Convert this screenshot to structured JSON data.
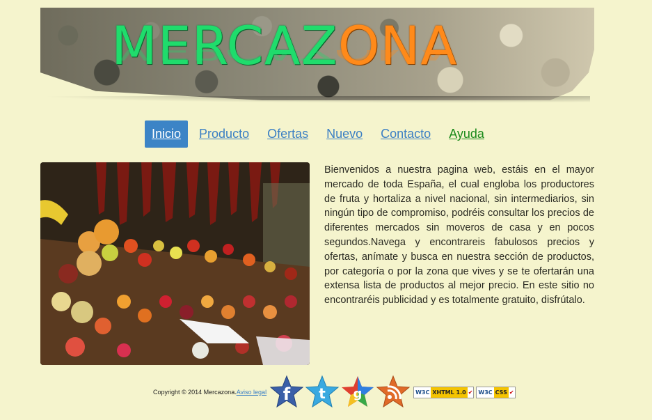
{
  "header": {
    "logo_part1": "MERCAZ",
    "logo_part2": "ONA",
    "logo_colors": {
      "part1": "#1fdc6c",
      "part2": "#ff8a1a"
    }
  },
  "nav": {
    "items": [
      {
        "label": "Inicio",
        "active": true
      },
      {
        "label": "Producto"
      },
      {
        "label": "Ofertas"
      },
      {
        "label": "Nuevo"
      },
      {
        "label": "Contacto"
      },
      {
        "label": "Ayuda",
        "color": "#1a8a1a"
      }
    ],
    "active_color": "#3c84c6",
    "link_color": "#3b7fc4"
  },
  "main": {
    "image_icon": "market-stall-photo",
    "intro_text": "Bienvenidos a nuestra pagina web, estáis en el mayor mercado de toda España, el cual engloba los productores de fruta y hortaliza a nivel nacional, sin intermediarios, sin ningún tipo de compromiso, podréis consultar los precios de diferentes mercados sin moveros de casa y en pocos segundos.Navega y encontrareis fabulosos precios y ofertas, anímate y busca en nuestra sección de productos, por categoría o por la zona que vives y se te ofertarán una extensa lista de productos al mejor precio. En este sitio no encontraréis publicidad y es totalmente gratuito, disfrútalo."
  },
  "footer": {
    "copyright": "Copyright © 2014 Mercazona.",
    "legal_link": "Aviso legal",
    "social": [
      {
        "icon": "facebook-icon",
        "glyph": "f",
        "color": "#3a5fa8"
      },
      {
        "icon": "twitter-icon",
        "glyph": "t",
        "color": "#39a9e0"
      },
      {
        "icon": "google-icon",
        "glyph": "g",
        "color": "#e04030"
      },
      {
        "icon": "rss-icon",
        "glyph": "rss",
        "color": "#e06a28"
      }
    ],
    "badges": [
      {
        "w3": "W3C",
        "kind": "XHTML 1.0"
      },
      {
        "w3": "W3C",
        "kind": "CSS"
      }
    ]
  }
}
